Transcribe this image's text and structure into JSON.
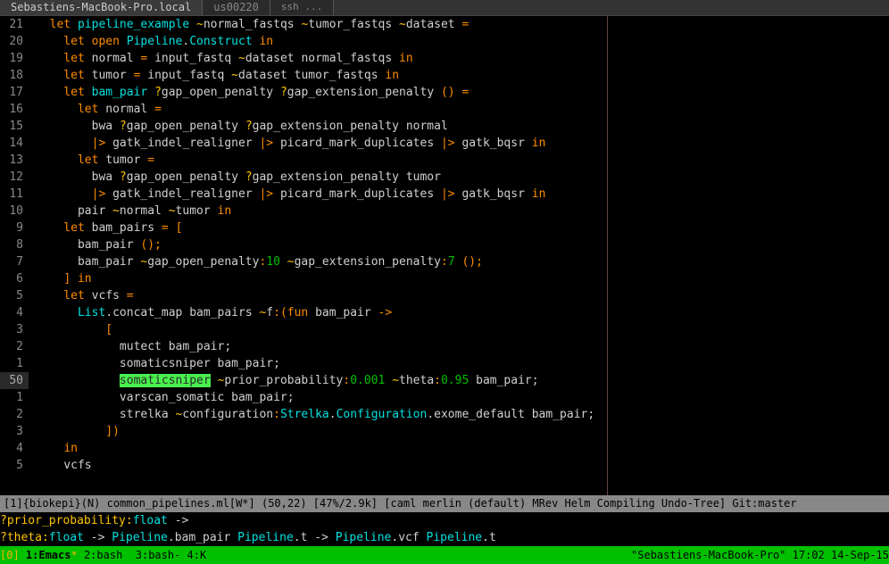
{
  "tabs": {
    "t0": "Sebastiens-MacBook-Pro.local",
    "t1": "us00220",
    "t2": "ssh ..."
  },
  "gutter": [
    "21",
    "20",
    "19",
    "18",
    "17",
    "16",
    "15",
    "14",
    "13",
    "12",
    "11",
    "10",
    "9",
    "8",
    "7",
    "6",
    "5",
    "4",
    "3",
    "2",
    "1",
    "50",
    "1",
    "2",
    "3",
    "4",
    "5",
    ""
  ],
  "code": {
    "l0": {
      "a": "  let ",
      "b": "pipeline_example ",
      "c": "~",
      "d": "normal_fastqs ",
      "e": "~",
      "f": "tumor_fastqs ",
      "g": "~",
      "h": "dataset ",
      "i": "="
    },
    "l1": {
      "a": "    let open ",
      "b": "Pipeline",
      "c": ".",
      "d": "Construct ",
      "e": "in"
    },
    "l2": {
      "a": "    let ",
      "b": "normal ",
      "c": "= ",
      "d": "input_fastq ",
      "e": "~",
      "f": "dataset normal_fastqs ",
      "g": "in"
    },
    "l3": {
      "a": "    let ",
      "b": "tumor ",
      "c": "= ",
      "d": "input_fastq ",
      "e": "~",
      "f": "dataset tumor_fastqs ",
      "g": "in"
    },
    "l4": {
      "a": "    let ",
      "b": "bam_pair ",
      "c": "?",
      "d": "gap_open_penalty ",
      "e": "?",
      "f": "gap_extension_penalty ",
      "g": "()",
      " h": " ="
    },
    "l5": {
      "a": "      let ",
      "b": "normal ",
      "c": "="
    },
    "l6": {
      "a": "        bwa ",
      "b": "?",
      "c": "gap_open_penalty ",
      "d": "?",
      "e": "gap_extension_penalty normal"
    },
    "l7": {
      "a": "        ",
      "b": "|> ",
      "c": "gatk_indel_realigner ",
      "d": "|> ",
      "e": "picard_mark_duplicates ",
      "f": "|> ",
      "g": "gatk_bqsr ",
      "h": "in"
    },
    "l8": {
      "a": "      let ",
      "b": "tumor ",
      "c": "="
    },
    "l9": {
      "a": "        bwa ",
      "b": "?",
      "c": "gap_open_penalty ",
      "d": "?",
      "e": "gap_extension_penalty tumor"
    },
    "l10": {
      "a": "        ",
      "b": "|> ",
      "c": "gatk_indel_realigner ",
      "d": "|> ",
      "e": "picard_mark_duplicates ",
      "f": "|> ",
      "g": "gatk_bqsr ",
      "h": "in"
    },
    "l11": {
      "a": "      pair ",
      "b": "~",
      "c": "normal ",
      "d": "~",
      "e": "tumor ",
      "f": "in"
    },
    "l12": {
      "a": "    let ",
      "b": "bam_pairs ",
      "c": "= ",
      "d": "["
    },
    "l13": {
      "a": "      bam_pair ",
      "b": "();"
    },
    "l14": {
      "a": "      bam_pair ",
      "b": "~",
      "c": "gap_open_penalty",
      "d": ":",
      "e": "10 ",
      "f": "~",
      "g": "gap_extension_penalty",
      "h": ":",
      "i": "7 ",
      "j": "();"
    },
    "l15": {
      "a": "    ",
      "b": "] ",
      "c": "in"
    },
    "l16": {
      "a": "    let ",
      "b": "vcfs ",
      "c": "="
    },
    "l17": {
      "a": "      ",
      "b": "List",
      "c": ".concat_map bam_pairs ",
      "d": "~",
      "e": "f",
      "f": ":(",
      "g": "fun ",
      "h": "bam_pair ",
      "i": "->"
    },
    "l18": {
      "a": "          ",
      "b": "["
    },
    "l19": {
      "a": "            mutect bam_pair;"
    },
    "l20": {
      "a": "            somaticsniper bam_pair;"
    },
    "l21": {
      "a": "            ",
      "b": "somaticsniper",
      "c": " ",
      "d": "~",
      "e": "prior_probability",
      "f": ":",
      "g": "0.001 ",
      "h": "~",
      "i": "theta",
      "j": ":",
      "k": "0.95 ",
      "l": "bam_pair;"
    },
    "l22": {
      "a": "            varscan_somatic bam_pair;"
    },
    "l23": {
      "a": "            strelka ",
      "b": "~",
      "c": "configuration",
      "d": ":",
      "e": "Strelka",
      "f": ".",
      "g": "Configuration",
      "h": ".exome_default bam_pair;"
    },
    "l24": {
      "a": "          ",
      "b": "])"
    },
    "l25": {
      "a": "    ",
      "b": "in"
    },
    "l26": {
      "a": "    vcfs"
    }
  },
  "modeline": "[1]{biokepi}(N) common_pipelines.ml[W*] (50,22) [47%/2.9k] [caml merlin (default) MRev Helm Compiling Undo-Tree] Git:master",
  "hint1": {
    "a": "?prior_probability:",
    "b": "float ",
    "c": "->"
  },
  "hint2": {
    "a": "?theta:",
    "b": "float ",
    "c": "-> ",
    "d": "Pipeline",
    "e": ".bam_pair ",
    "f": "Pipeline",
    "g": ".t ",
    "h": "-> ",
    "i": "Pipeline",
    "j": ".vcf ",
    "k": "Pipeline",
    "l": ".t"
  },
  "tmux": {
    "session": "[0] ",
    "w1": "1:Emacs",
    "star": "*",
    "rest": " 2:bash  3:bash- 4:K",
    "right": "\"Sebastiens-MacBook-Pro\" 17:02 14-Sep-15"
  }
}
